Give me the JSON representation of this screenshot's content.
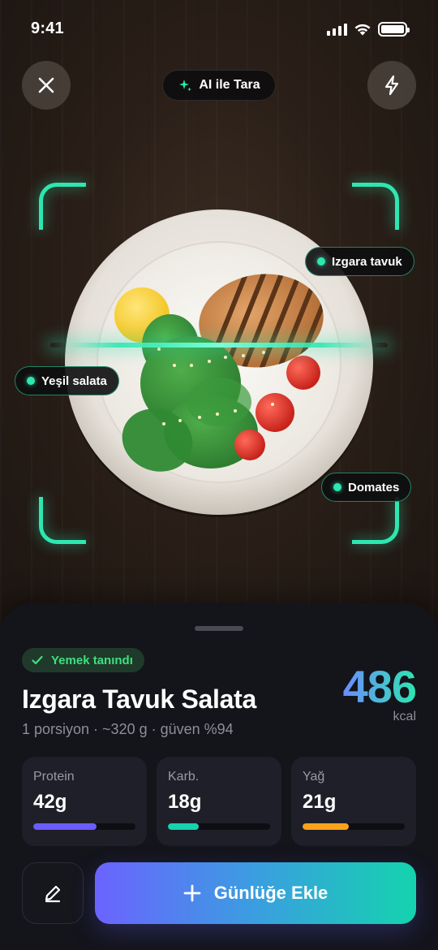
{
  "status_bar": {
    "time": "9:41",
    "icons": [
      "signal-icon",
      "wifi-icon",
      "battery-icon"
    ]
  },
  "top_bar": {
    "close_icon": "close-icon",
    "ai_pill_label": "AI ile Tara",
    "ai_pill_icon": "sparkle-icon",
    "flash_icon": "flash-icon"
  },
  "camera": {
    "scan_frame_color": "#2ee6b0",
    "detections": [
      {
        "label": "Izgara tavuk"
      },
      {
        "label": "Yeşil salata"
      },
      {
        "label": "Domates"
      }
    ]
  },
  "result": {
    "status_badge": "Yemek tanındı",
    "meal_name": "Izgara Tavuk Salata",
    "meal_meta": "1 porsiyon · ~320 g · güven %94",
    "calories": "486",
    "calories_unit": "kcal"
  },
  "macros": [
    {
      "label": "Protein",
      "value": "42g",
      "fill_fraction": 0.62,
      "color": "#6b5cff"
    },
    {
      "label": "Karb.",
      "value": "18g",
      "fill_fraction": 0.3,
      "color": "#14d3ae"
    },
    {
      "label": "Yağ",
      "value": "21g",
      "fill_fraction": 0.45,
      "color": "#ffa21a"
    }
  ],
  "actions": {
    "edit_icon": "pencil-icon",
    "add_label": "Günlüğe Ekle",
    "add_icon": "plus-icon"
  },
  "colors": {
    "accent_teal": "#2ee6b0",
    "accent_purple": "#6b63ff",
    "success_green": "#3ee07f",
    "sheet_bg": "#14141b"
  }
}
